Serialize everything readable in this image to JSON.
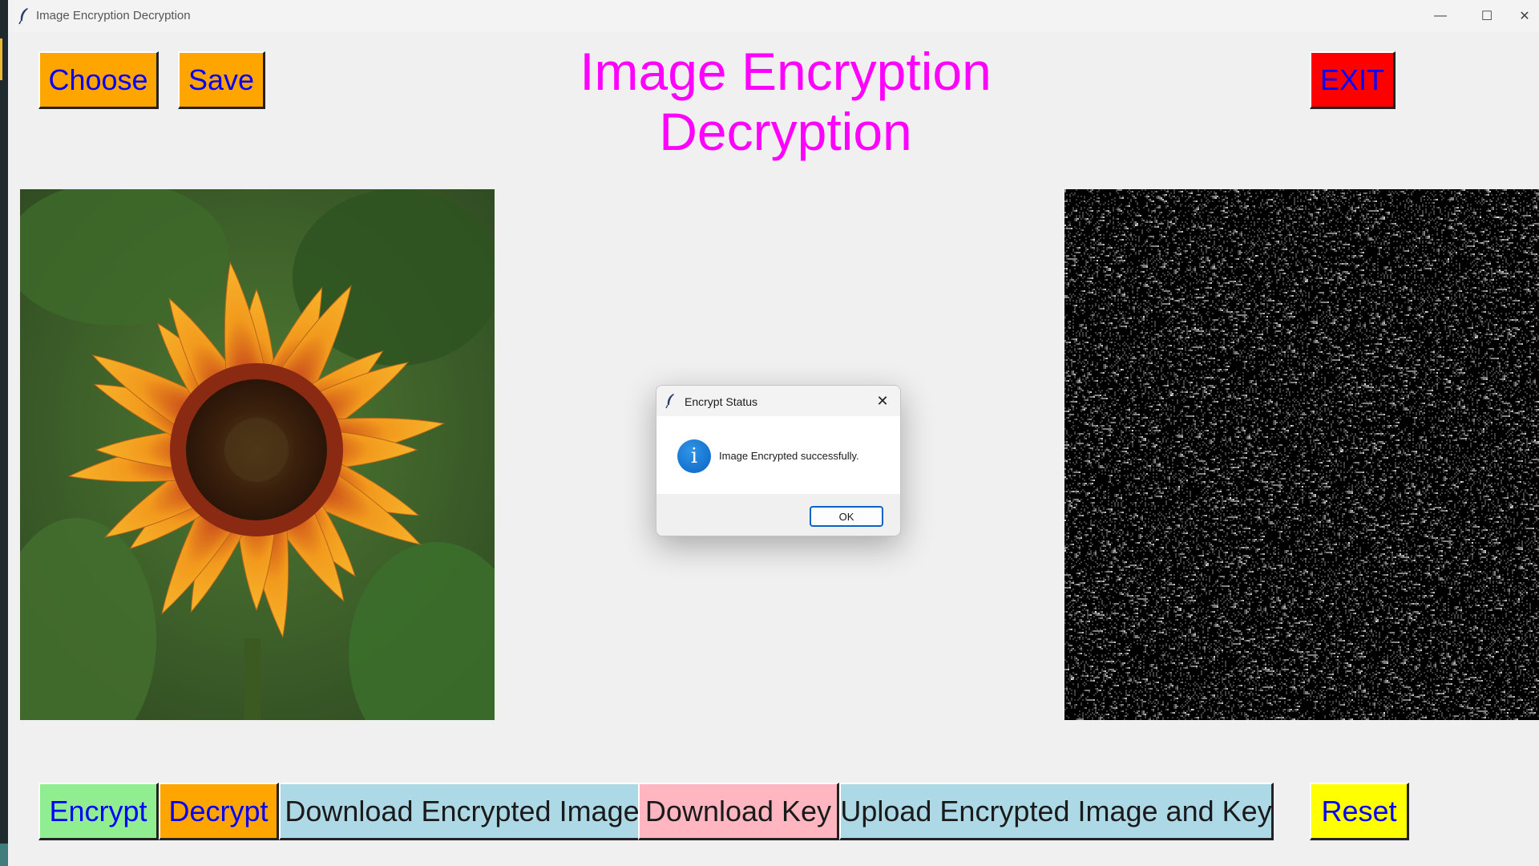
{
  "window": {
    "title": "Image Encryption Decryption",
    "controls": {
      "minimize": "—",
      "maximize": "☐",
      "close": "✕"
    }
  },
  "toolbar": {
    "choose_label": "Choose",
    "save_label": "Save",
    "exit_label": "EXIT"
  },
  "header": {
    "title_line1": "Image Encryption",
    "title_line2": "Decryption"
  },
  "images": {
    "original_icon": "sunflower-image",
    "encrypted_icon": "noise-image"
  },
  "actions": {
    "encrypt_label": "Encrypt",
    "decrypt_label": "Decrypt",
    "download_encrypted_label": "Download Encrypted Image",
    "download_key_label": "Download Key",
    "upload_label": "Upload Encrypted Image and Key",
    "reset_label": "Reset"
  },
  "dialog": {
    "title": "Encrypt Status",
    "message": "Image Encrypted successfully.",
    "ok_label": "OK",
    "info_glyph": "i",
    "close_glyph": "✕"
  },
  "colors": {
    "title": "#ff00ff",
    "button_text": "#0000ff",
    "choose_bg": "#ffa500",
    "exit_bg": "#ff0000",
    "encrypt_bg": "#90ee90",
    "download_bg": "#add8e6",
    "download_key_bg": "#ffb6c1",
    "reset_bg": "#ffff00"
  }
}
